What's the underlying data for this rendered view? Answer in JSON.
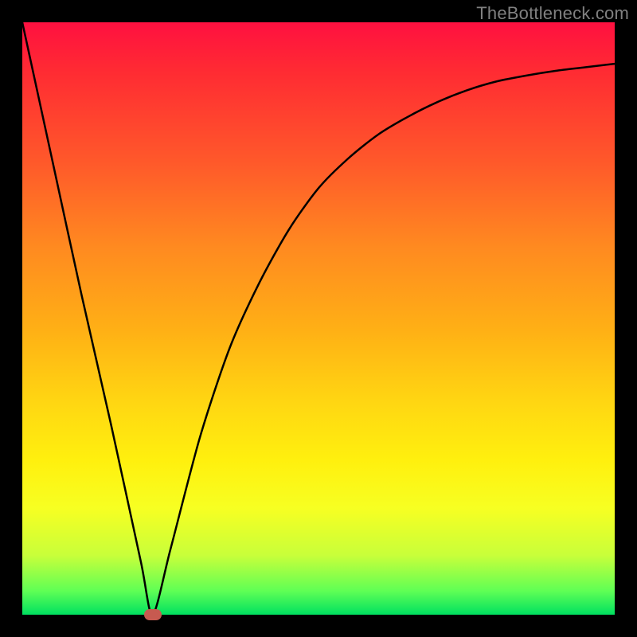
{
  "watermark": "TheBottleneck.com",
  "chart_data": {
    "type": "line",
    "title": "",
    "xlabel": "",
    "ylabel": "",
    "xlim": [
      0,
      100
    ],
    "ylim": [
      0,
      100
    ],
    "series": [
      {
        "name": "curve",
        "x": [
          0,
          5,
          10,
          15,
          20,
          22,
          25,
          30,
          35,
          40,
          45,
          50,
          55,
          60,
          65,
          70,
          75,
          80,
          85,
          90,
          95,
          100
        ],
        "values": [
          100,
          77,
          54,
          32,
          9,
          0,
          11,
          30,
          45,
          56,
          65,
          72,
          77,
          81,
          84,
          86.5,
          88.5,
          90,
          91,
          91.8,
          92.4,
          93
        ]
      }
    ],
    "marker": {
      "x": 22,
      "y": 0
    },
    "background_gradient": {
      "top": "#ff1040",
      "mid": "#ffd612",
      "bottom": "#00e060"
    }
  }
}
